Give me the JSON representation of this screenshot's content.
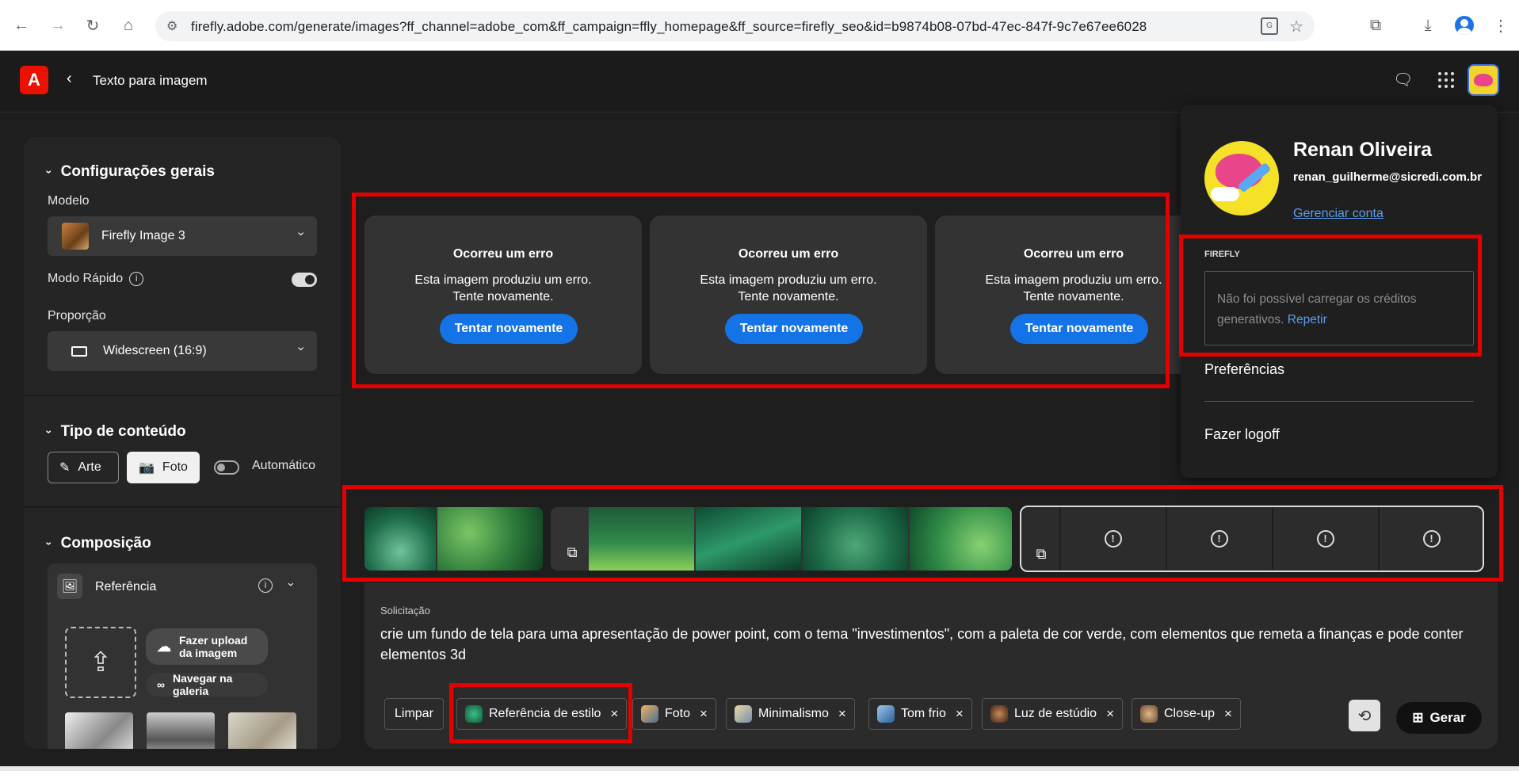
{
  "browser": {
    "url": "firefly.adobe.com/generate/images?ff_channel=adobe_com&ff_campaign=ffly_homepage&ff_source=firefly_seo&id=b9874b08-07bd-47ec-847f-9c7e67ee6028"
  },
  "header": {
    "title": "Texto para imagem"
  },
  "settings": {
    "general_title": "Configurações gerais",
    "model_label": "Modelo",
    "model_value": "Firefly Image 3",
    "fast_mode_label": "Modo Rápido",
    "fast_mode_on": true,
    "ratio_label": "Proporção",
    "ratio_value": "Widescreen (16:9)"
  },
  "content_type": {
    "title": "Tipo de conteúdo",
    "art": "Arte",
    "photo": "Foto",
    "auto": "Automático",
    "selected": "Foto"
  },
  "composition": {
    "title": "Composição",
    "reference_label": "Referência",
    "upload_label": "Fazer upload da imagem",
    "browse_label": "Navegar na galeria"
  },
  "errors": [
    {
      "title": "Ocorreu um erro",
      "line1": "Esta imagem produziu um erro.",
      "line2": "Tente novamente.",
      "button": "Tentar novamente"
    },
    {
      "title": "Ocorreu um erro",
      "line1": "Esta imagem produziu um erro.",
      "line2": "Tente novamente.",
      "button": "Tentar novamente"
    },
    {
      "title": "Ocorreu um erro",
      "line1": "Esta imagem produziu um erro.",
      "line2": "Tente novamente.",
      "button": "Tentar novamente"
    }
  ],
  "prompt": {
    "label": "Solicitação",
    "text": "crie um fundo de tela para uma apresentação de power point, com o tema \"investimentos\", com a paleta de cor verde, com elementos que remeta a finanças e pode conter elementos 3d",
    "clear": "Limpar",
    "chips": [
      "Referência de estilo",
      "Foto",
      "Minimalismo",
      "Tom frio",
      "Luz de estúdio",
      "Close-up"
    ],
    "generate": "Gerar"
  },
  "account": {
    "name": "Renan Oliveira",
    "email": "renan_guilherme@sicredi.com.br",
    "manage": "Gerenciar conta",
    "section": "FIREFLY",
    "credits_error": "Não foi possível carregar os créditos generativos.",
    "credits_retry": "Repetir",
    "preferences": "Preferências",
    "logout": "Fazer logoff"
  },
  "colors": {
    "accent_blue": "#1473e6",
    "highlight_red": "#e40000",
    "adobe_red": "#eb1000"
  }
}
